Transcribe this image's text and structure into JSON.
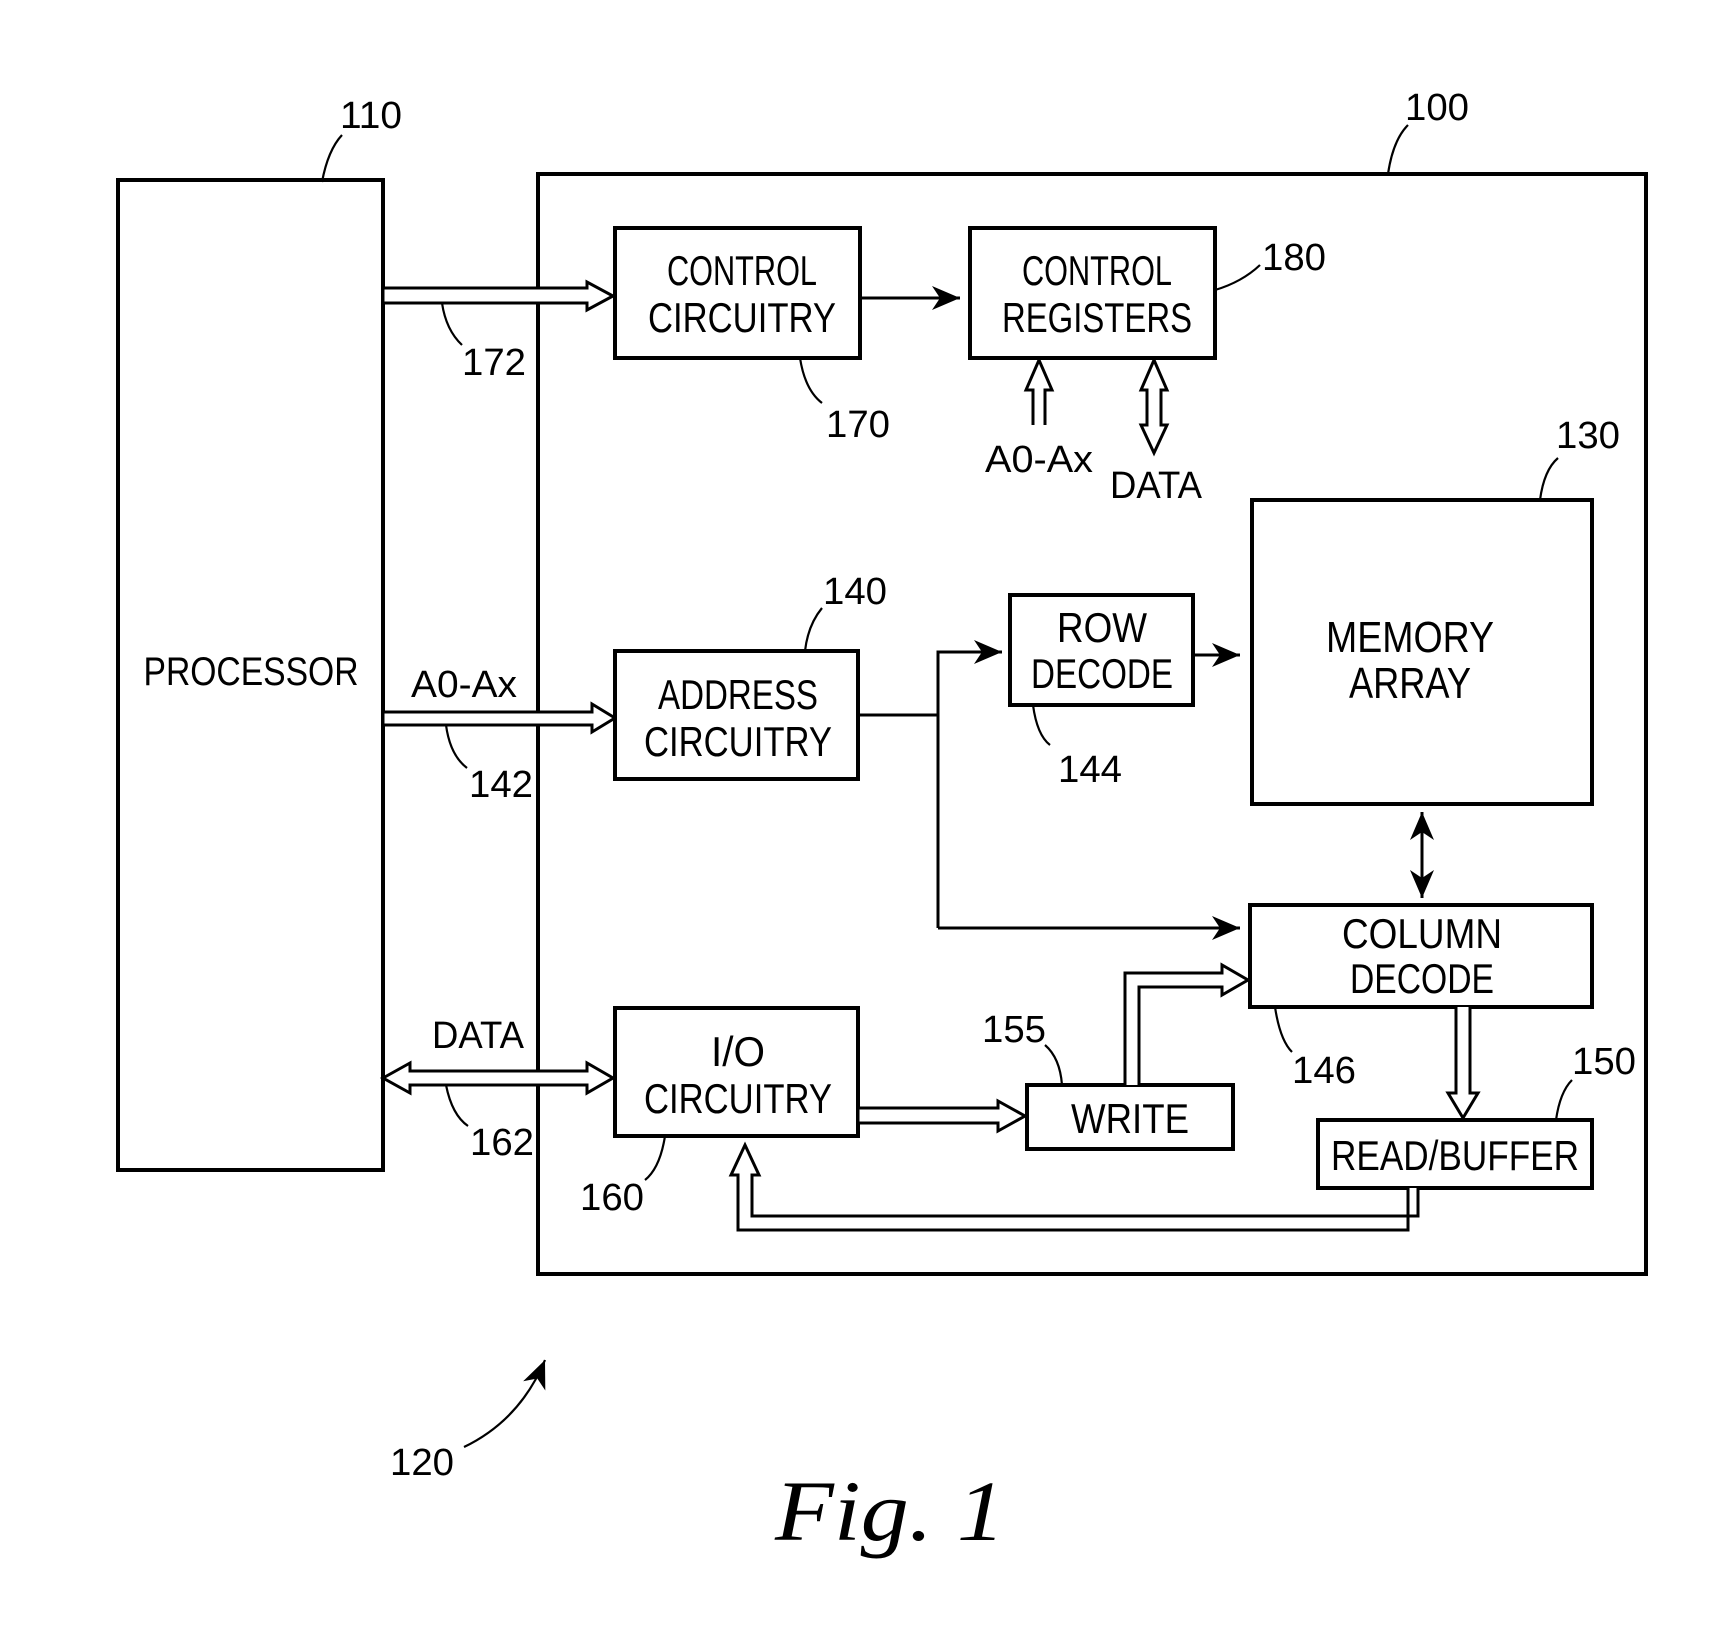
{
  "figure": {
    "caption": "Fig. 1",
    "system_ref": "120"
  },
  "blocks": {
    "processor": {
      "label": "PROCESSOR",
      "ref": "110"
    },
    "memory_device": {
      "ref": "100"
    },
    "control_circuitry": {
      "line1": "CONTROL",
      "line2": "CIRCUITRY",
      "ref": "170"
    },
    "control_registers": {
      "line1": "CONTROL",
      "line2": "REGISTERS",
      "ref": "180"
    },
    "address_circuitry": {
      "line1": "ADDRESS",
      "line2": "CIRCUITRY",
      "ref": "140"
    },
    "row_decode": {
      "line1": "ROW",
      "line2": "DECODE",
      "ref": "144"
    },
    "memory_array": {
      "line1": "MEMORY",
      "line2": "ARRAY",
      "ref": "130"
    },
    "column_decode": {
      "line1": "COLUMN",
      "line2": "DECODE",
      "ref": "146"
    },
    "io_circuitry": {
      "line1": "I/O",
      "line2": "CIRCUITRY",
      "ref": "160"
    },
    "write": {
      "label": "WRITE",
      "ref": "155"
    },
    "read_buffer": {
      "label": "READ/BUFFER",
      "ref": "150"
    }
  },
  "connections": {
    "control_bus": {
      "ref": "172"
    },
    "address_bus": {
      "label": "A0-Ax",
      "ref": "142"
    },
    "data_bus": {
      "label": "DATA",
      "ref": "162"
    },
    "register_address": {
      "label": "A0-Ax"
    },
    "register_data": {
      "label": "DATA"
    }
  }
}
